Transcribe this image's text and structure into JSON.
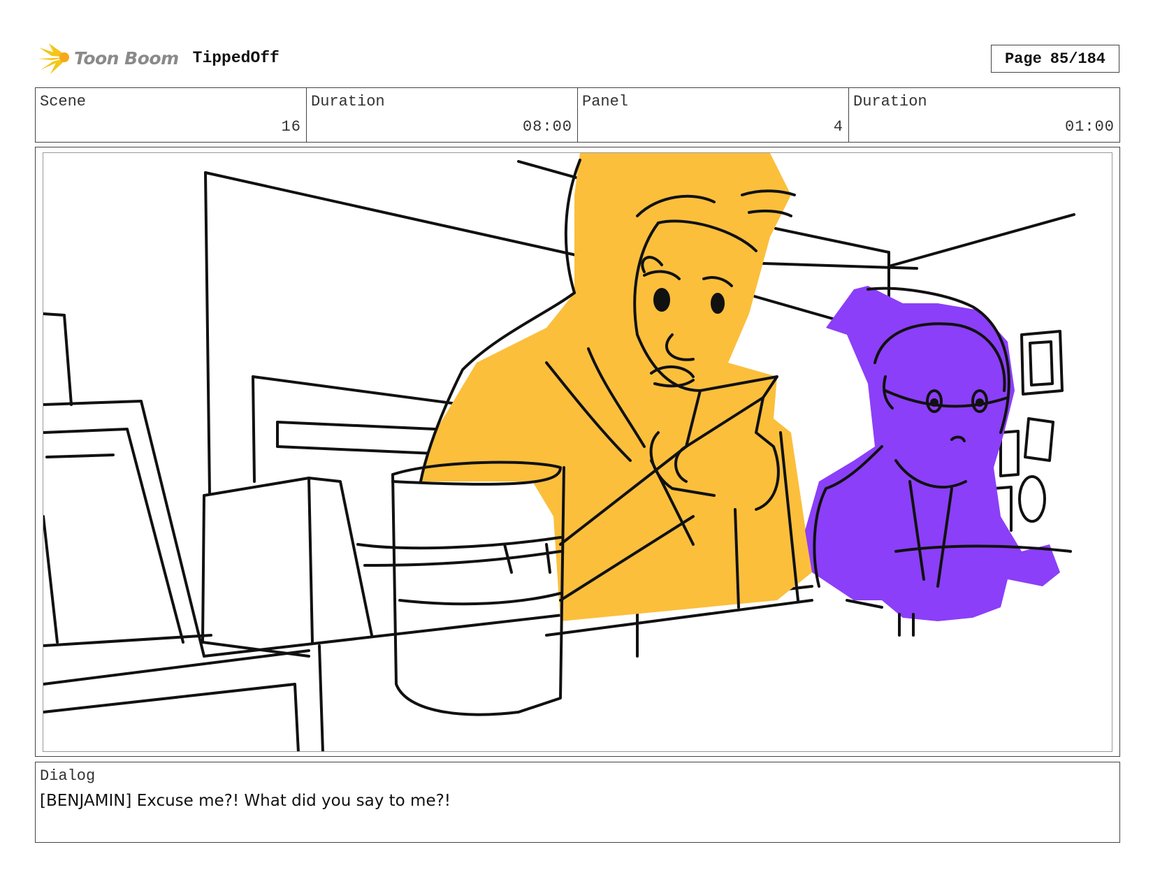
{
  "header": {
    "logo_text": "Toon Boom",
    "project_title": "TippedOff",
    "page_label": "Page",
    "page_number": "85/184"
  },
  "info": {
    "scene_label": "Scene",
    "scene_value": "16",
    "scene_duration_label": "Duration",
    "scene_duration_value": "08:00",
    "panel_label": "Panel",
    "panel_value": "4",
    "panel_duration_label": "Duration",
    "panel_duration_value": "01:00"
  },
  "dialog": {
    "label": "Dialog",
    "text": "[BENJAMIN] Excuse me?! What did you say to me?!"
  },
  "colors": {
    "benjamin_fill": "#FBBF3C",
    "girl_fill": "#8B3FF8",
    "logo_accent": "#F5C518",
    "logo_text": "#8a8a8a"
  }
}
